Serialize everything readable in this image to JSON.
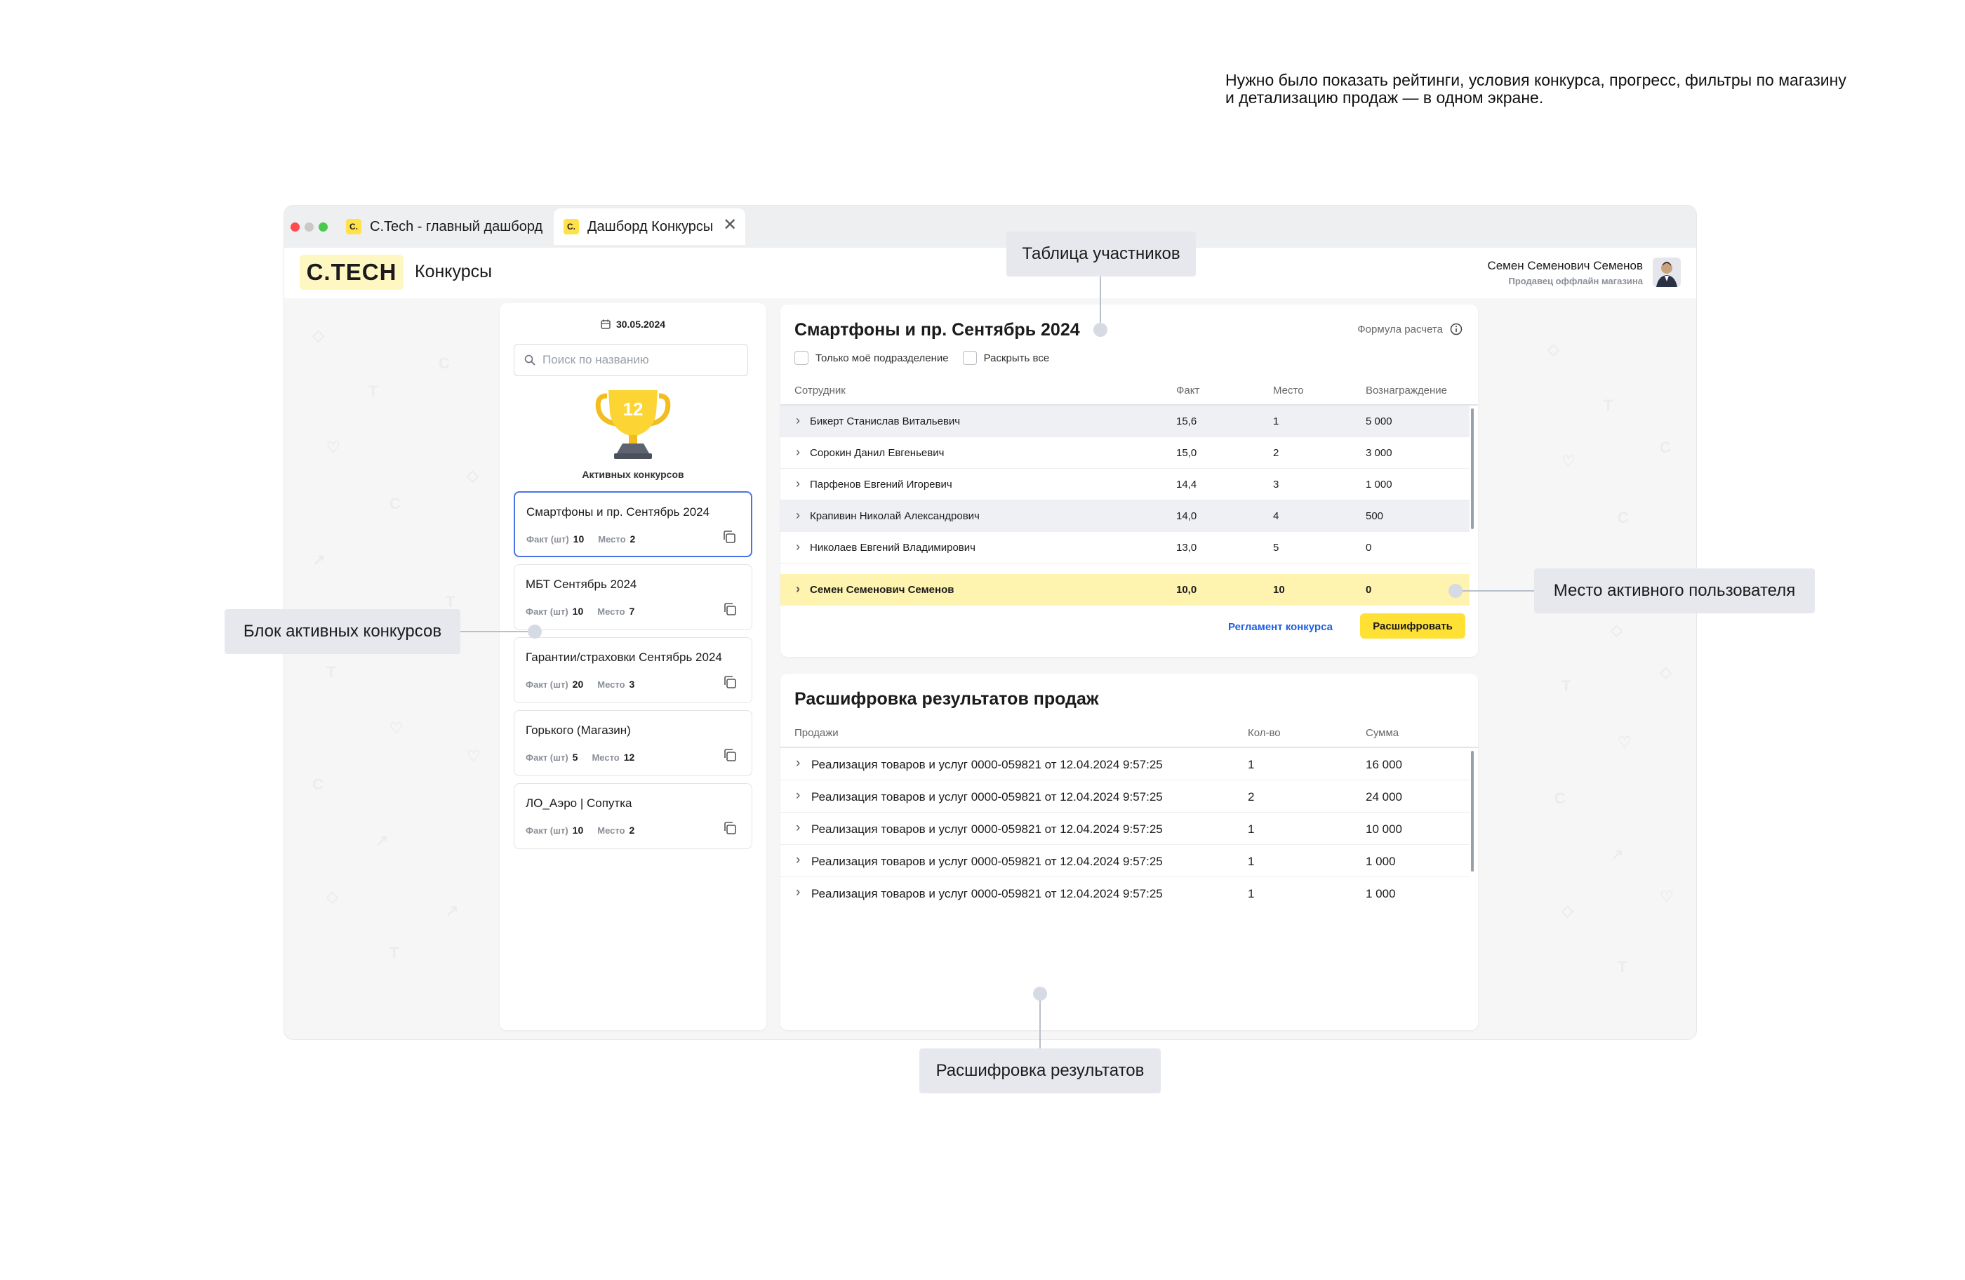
{
  "intro_text": "Нужно было показать рейтинги, условия конкурса, прогресс, фильтры по магазину и детализацию продаж — в одном экране.",
  "browser": {
    "tabs": [
      {
        "favicon": "С.",
        "label": "C.Tech - главный дашборд"
      },
      {
        "favicon": "С.",
        "label": "Дашборд Конкурсы"
      }
    ],
    "close_glyph": "✕"
  },
  "app": {
    "logo": "С.TECH",
    "title": "Конкурсы",
    "user_name": "Семен Семенович Семенов",
    "user_role": "Продавец оффлайн магазина"
  },
  "sidebar": {
    "date": "30.05.2024",
    "search_placeholder": "Поиск по названию",
    "active_count": "12",
    "active_label": "Активных конкурсов",
    "contests": [
      {
        "title": "Смартфоны и пр. Сентябрь 2024",
        "fact_label": "Факт (шт)",
        "fact": "10",
        "place_label": "Место",
        "place": "2"
      },
      {
        "title": "МБТ Сентябрь 2024",
        "fact_label": "Факт (шт)",
        "fact": "10",
        "place_label": "Место",
        "place": "7"
      },
      {
        "title": "Гарантии/страховки Сентябрь 2024",
        "fact_label": "Факт (шт)",
        "fact": "20",
        "place_label": "Место",
        "place": "3"
      },
      {
        "title": "Горького (Магазин)",
        "fact_label": "Факт (шт)",
        "fact": "5",
        "place_label": "Место",
        "place": "12"
      },
      {
        "title": "ЛО_Аэро | Сопутка",
        "fact_label": "Факт (шт)",
        "fact": "10",
        "place_label": "Место",
        "place": "2"
      }
    ]
  },
  "participants": {
    "title": "Смартфоны и пр. Сентябрь 2024",
    "formula_label": "Формула расчета",
    "only_my_department": "Только моё подразделение",
    "expand_all": "Раскрыть все",
    "columns": {
      "employee": "Сотрудник",
      "fact": "Факт",
      "place": "Место",
      "reward": "Вознаграждение"
    },
    "rows": [
      {
        "name": "Бикерт Станислав Витальевич",
        "fact": "15,6",
        "place": "1",
        "reward": "5 000"
      },
      {
        "name": "Сорокин Данил Евгеньевич",
        "fact": "15,0",
        "place": "2",
        "reward": "3 000"
      },
      {
        "name": "Парфенов Евгений Игоревич",
        "fact": "14,4",
        "place": "3",
        "reward": "1 000"
      },
      {
        "name": "Крапивин Николай Александрович",
        "fact": "14,0",
        "place": "4",
        "reward": "500"
      },
      {
        "name": "Николаев Евгений Владимирович",
        "fact": "13,0",
        "place": "5",
        "reward": "0"
      }
    ],
    "current_user": {
      "name": "Семен Семенович Семенов",
      "fact": "10,0",
      "place": "10",
      "reward": "0"
    },
    "rules_link": "Регламент конкурса",
    "decode_button": "Расшифровать"
  },
  "sales": {
    "title": "Расшифровка результатов продаж",
    "columns": {
      "sales": "Продажи",
      "qty": "Кол-во",
      "sum": "Сумма"
    },
    "rows": [
      {
        "doc": "Реализация товаров и услуг 0000-059821 от 12.04.2024 9:57:25",
        "qty": "1",
        "sum": "16 000"
      },
      {
        "doc": "Реализация товаров и услуг 0000-059821 от 12.04.2024 9:57:25",
        "qty": "2",
        "sum": "24 000"
      },
      {
        "doc": "Реализация товаров и услуг 0000-059821 от 12.04.2024 9:57:25",
        "qty": "1",
        "sum": "10 000"
      },
      {
        "doc": "Реализация товаров и услуг 0000-059821 от 12.04.2024 9:57:25",
        "qty": "1",
        "sum": "1 000"
      },
      {
        "doc": "Реализация товаров и услуг 0000-059821 от 12.04.2024 9:57:25",
        "qty": "1",
        "sum": "1 000"
      }
    ]
  },
  "callouts": {
    "participants_table": "Таблица участников",
    "active_user_place": "Место активного пользователя",
    "active_contests_block": "Блок активных конкурсов",
    "results_decoding": "Расшифровка результатов"
  },
  "colors": {
    "accent_yellow": "#ffe135",
    "highlight_row": "#fff3b0",
    "active_border": "#4a73e8",
    "link_blue": "#1f5fe0"
  },
  "icons": {
    "calendar": "calendar-icon",
    "search": "search-icon",
    "trophy": "trophy-icon",
    "copy": "copy-icon",
    "info": "info-icon",
    "chevron": "chevron-right-icon"
  }
}
